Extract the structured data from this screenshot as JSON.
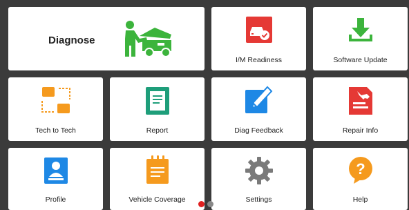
{
  "tiles": {
    "diagnose": {
      "label": "Diagnose"
    },
    "im_readiness": {
      "label": "I/M Readiness"
    },
    "software_update": {
      "label": "Software Update"
    },
    "tech_to_tech": {
      "label": "Tech to Tech"
    },
    "report": {
      "label": "Report"
    },
    "diag_feedback": {
      "label": "Diag Feedback"
    },
    "repair_info": {
      "label": "Repair Info"
    },
    "profile": {
      "label": "Profile"
    },
    "vehicle_coverage": {
      "label": "Vehicle Coverage"
    },
    "settings": {
      "label": "Settings"
    },
    "help": {
      "label": "Help"
    }
  },
  "icons": {
    "diagnose": "mechanic-car-icon",
    "im_readiness": "car-check-icon",
    "software_update": "download-icon",
    "tech_to_tech": "connected-screens-icon",
    "report": "report-document-icon",
    "diag_feedback": "edit-pencil-icon",
    "repair_info": "wrench-document-icon",
    "profile": "user-card-icon",
    "vehicle_coverage": "notepad-icon",
    "settings": "gear-icon",
    "help": "question-bubble-icon"
  },
  "pagination": {
    "pages": 2,
    "active": 1
  },
  "colors": {
    "background": "#3b3b3b",
    "tile": "#ffffff",
    "green": "#3cb43c",
    "red": "#e53935",
    "orange": "#f59a1e",
    "teal": "#1e9e7a",
    "blue": "#1e88e5",
    "gray": "#7a7a7a",
    "active_dot": "#e02020",
    "inactive_dot": "#888888"
  }
}
